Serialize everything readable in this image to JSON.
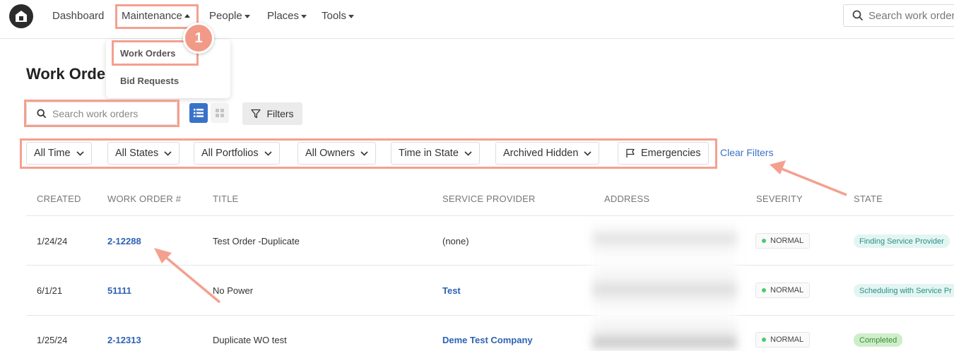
{
  "nav": {
    "items": [
      "Dashboard",
      "Maintenance",
      "People",
      "Places",
      "Tools"
    ],
    "search_placeholder": "Search work orders"
  },
  "maintenance_menu": {
    "items": [
      "Work Orders",
      "Bid Requests"
    ]
  },
  "step_badge": "1",
  "page": {
    "title": "Work Orders",
    "search_placeholder": "Search work orders",
    "filters_label": "Filters",
    "chips": [
      "All Time",
      "All States",
      "All Portfolios",
      "All Owners",
      "Time in State",
      "Archived Hidden",
      "Emergencies"
    ],
    "clear_filters": "Clear Filters"
  },
  "table": {
    "columns": [
      "CREATED",
      "WORK ORDER #",
      "TITLE",
      "SERVICE PROVIDER",
      "ADDRESS",
      "SEVERITY",
      "STATE"
    ],
    "rows": [
      {
        "created": "1/24/24",
        "number": "2-12288",
        "title": "Test Order -Duplicate",
        "provider": "(none)",
        "severity": "NORMAL",
        "state": "Finding Service Provider"
      },
      {
        "created": "6/1/21",
        "number": "51111",
        "title": "No Power",
        "provider": "Test",
        "severity": "NORMAL",
        "state": "Scheduling with Service Pr"
      },
      {
        "created": "1/25/24",
        "number": "2-12313",
        "title": "Duplicate WO test",
        "provider": "Deme Test Company",
        "severity": "NORMAL",
        "state": "Completed"
      }
    ]
  },
  "colors": {
    "accent": "#2e62b3",
    "highlight": "#f4a08f",
    "severity_dot": "#4cc96e"
  }
}
